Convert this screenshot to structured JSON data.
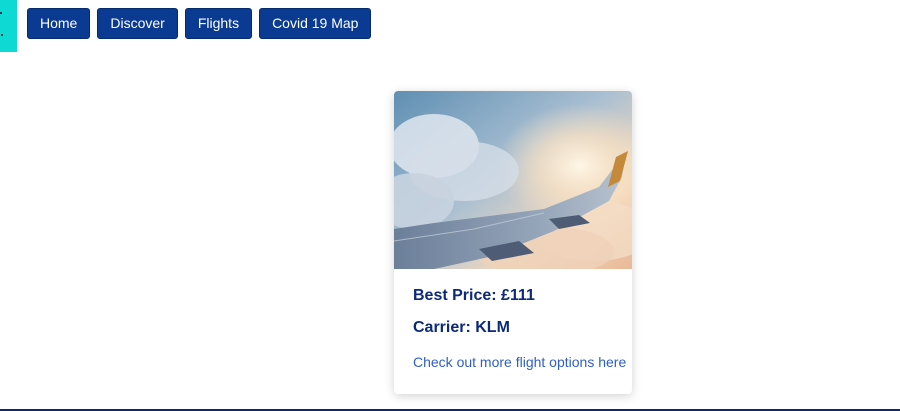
{
  "nav": {
    "items": [
      {
        "label": "Home"
      },
      {
        "label": "Discover"
      },
      {
        "label": "Flights"
      },
      {
        "label": "Covid 19 Map"
      }
    ]
  },
  "card": {
    "image_subject": "airplane wing above clouds at sunset",
    "price": "Best Price: £111",
    "carrier": "Carrier: KLM",
    "link": "Check out more flight options here"
  },
  "colors": {
    "nav_button": "#0a3a91",
    "logo_tab": "#0ed9d3",
    "heading_text": "#0c2a7a",
    "link_text": "#2f5fc4"
  }
}
